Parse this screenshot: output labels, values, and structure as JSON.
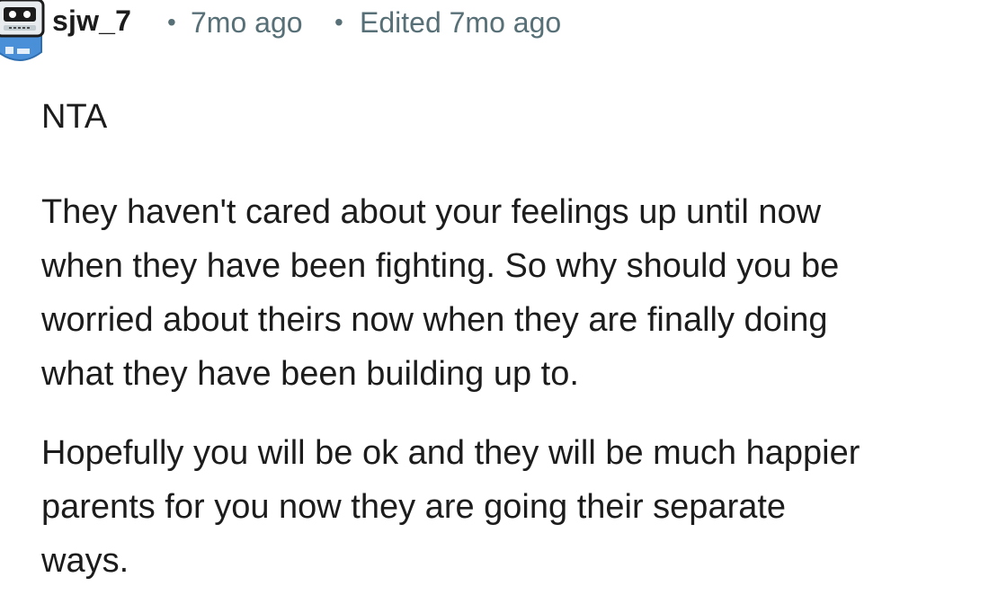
{
  "comment": {
    "author": "sjw_7",
    "time_ago": "7mo ago",
    "edited_label": "Edited 7mo ago",
    "separator": "•",
    "paragraphs": [
      "NTA",
      "They haven't cared about your feelings up until now\nwhen they have been fighting. So why should you be\nworried about theirs now when they are finally doing\nwhat they have been building up to.",
      "Hopefully you will be ok and they will be much happier\nparents for you now they are going their separate\nways."
    ]
  },
  "icons": {
    "avatar": "robot-avatar-icon"
  },
  "colors": {
    "text": "#1c1c1c",
    "meta": "#576f76",
    "avatar_blue": "#4a90d9"
  }
}
